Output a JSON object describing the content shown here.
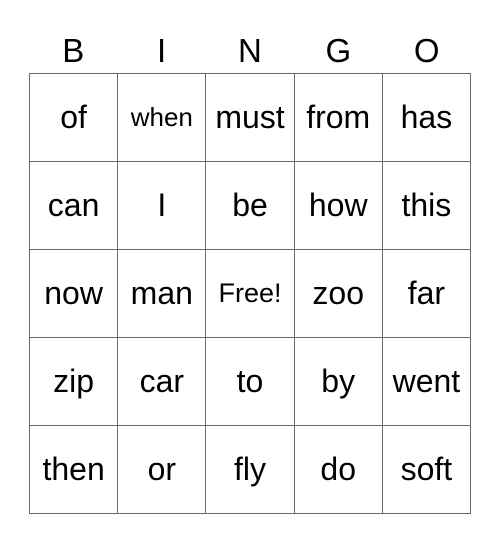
{
  "card": {
    "header": [
      "B",
      "I",
      "N",
      "G",
      "O"
    ],
    "rows": [
      [
        "of",
        "when",
        "must",
        "from",
        "has"
      ],
      [
        "can",
        "I",
        "be",
        "how",
        "this"
      ],
      [
        "now",
        "man",
        "Free!",
        "zoo",
        "far"
      ],
      [
        "zip",
        "car",
        "to",
        "by",
        "went"
      ],
      [
        "then",
        "or",
        "fly",
        "do",
        "soft"
      ]
    ],
    "free_space_label": "Free!",
    "grid_line_color": "#6a6a6a"
  }
}
